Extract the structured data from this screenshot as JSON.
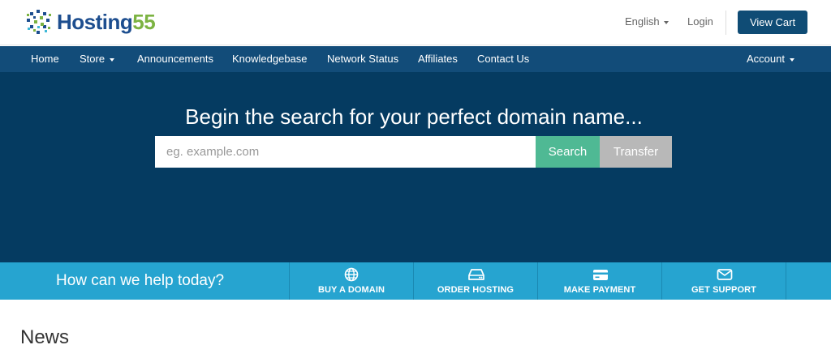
{
  "brand": {
    "name_word": "Hosting",
    "name_number": "55"
  },
  "topbar": {
    "language": "English",
    "login": "Login",
    "view_cart": "View Cart"
  },
  "nav": {
    "items": [
      {
        "label": "Home",
        "dropdown": false
      },
      {
        "label": "Store",
        "dropdown": true
      },
      {
        "label": "Announcements",
        "dropdown": false
      },
      {
        "label": "Knowledgebase",
        "dropdown": false
      },
      {
        "label": "Network Status",
        "dropdown": false
      },
      {
        "label": "Affiliates",
        "dropdown": false
      },
      {
        "label": "Contact Us",
        "dropdown": false
      }
    ],
    "account": "Account"
  },
  "hero": {
    "title": "Begin the search for your perfect domain name...",
    "search_placeholder": "eg. example.com",
    "search_value": "",
    "search_button": "Search",
    "transfer_button": "Transfer"
  },
  "help": {
    "title": "How can we help today?",
    "links": [
      {
        "label": "BUY A DOMAIN",
        "icon": "globe-icon"
      },
      {
        "label": "ORDER HOSTING",
        "icon": "server-icon"
      },
      {
        "label": "MAKE PAYMENT",
        "icon": "credit-card-icon"
      },
      {
        "label": "GET SUPPORT",
        "icon": "envelope-icon"
      }
    ]
  },
  "content": {
    "section_title": "News"
  },
  "colors": {
    "nav": "#124c79",
    "hero": "#053b61",
    "search": "#4fb994",
    "transfer": "#b8b8b8",
    "help": "#26a4d0",
    "brand_blue": "#1d4e8f",
    "brand_green": "#7cb342"
  }
}
